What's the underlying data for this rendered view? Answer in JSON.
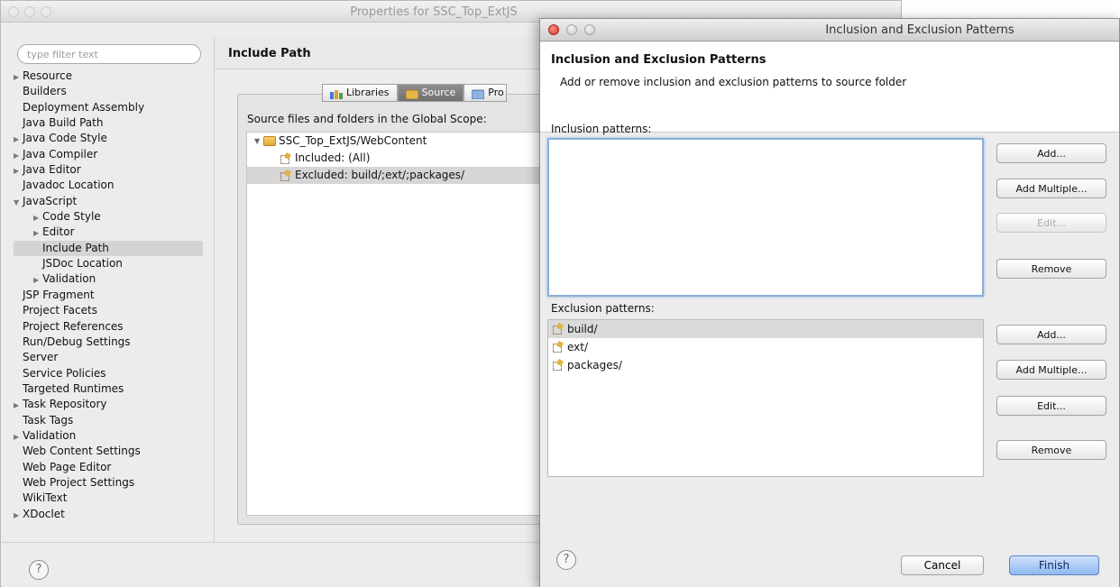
{
  "properties_window": {
    "title": "Properties for SSC_Top_ExtJS",
    "filter": {
      "placeholder": "type filter text",
      "value": ""
    },
    "nav": [
      {
        "label": "Resource",
        "arrow": "▶",
        "level": 0
      },
      {
        "label": "Builders",
        "arrow": "",
        "level": 0
      },
      {
        "label": "Deployment Assembly",
        "arrow": "",
        "level": 0
      },
      {
        "label": "Java Build Path",
        "arrow": "",
        "level": 0
      },
      {
        "label": "Java Code Style",
        "arrow": "▶",
        "level": 0
      },
      {
        "label": "Java Compiler",
        "arrow": "▶",
        "level": 0
      },
      {
        "label": "Java Editor",
        "arrow": "▶",
        "level": 0
      },
      {
        "label": "Javadoc Location",
        "arrow": "",
        "level": 0
      },
      {
        "label": "JavaScript",
        "arrow": "▼",
        "level": 0
      },
      {
        "label": "Code Style",
        "arrow": "▶",
        "level": 1
      },
      {
        "label": "Editor",
        "arrow": "▶",
        "level": 1
      },
      {
        "label": "Include Path",
        "arrow": "",
        "level": 1,
        "selected": true
      },
      {
        "label": "JSDoc Location",
        "arrow": "",
        "level": 1
      },
      {
        "label": "Validation",
        "arrow": "▶",
        "level": 1
      },
      {
        "label": "JSP Fragment",
        "arrow": "",
        "level": 0
      },
      {
        "label": "Project Facets",
        "arrow": "",
        "level": 0
      },
      {
        "label": "Project References",
        "arrow": "",
        "level": 0
      },
      {
        "label": "Run/Debug Settings",
        "arrow": "",
        "level": 0
      },
      {
        "label": "Server",
        "arrow": "",
        "level": 0
      },
      {
        "label": "Service Policies",
        "arrow": "",
        "level": 0
      },
      {
        "label": "Targeted Runtimes",
        "arrow": "",
        "level": 0
      },
      {
        "label": "Task Repository",
        "arrow": "▶",
        "level": 0
      },
      {
        "label": "Task Tags",
        "arrow": "",
        "level": 0
      },
      {
        "label": "Validation",
        "arrow": "▶",
        "level": 0
      },
      {
        "label": "Web Content Settings",
        "arrow": "",
        "level": 0
      },
      {
        "label": "Web Page Editor",
        "arrow": "",
        "level": 0
      },
      {
        "label": "Web Project Settings",
        "arrow": "",
        "level": 0
      },
      {
        "label": "WikiText",
        "arrow": "",
        "level": 0
      },
      {
        "label": "XDoclet",
        "arrow": "▶",
        "level": 0
      }
    ],
    "page_title": "Include Path",
    "tabs": [
      {
        "label": "Libraries",
        "active": false
      },
      {
        "label": "Source",
        "active": true
      },
      {
        "label": "Pro",
        "active": false
      }
    ],
    "scope_label": "Source files and folders in the Global Scope:",
    "source_tree": {
      "root_arrow": "▼",
      "root": "SSC_Top_ExtJS/WebContent",
      "included": "Included: (All)",
      "excluded": "Excluded: build/;ext/;packages/"
    },
    "help_glyph": "?"
  },
  "dialog": {
    "window_title": "Inclusion and Exclusion Patterns",
    "header_title": "Inclusion and Exclusion Patterns",
    "header_description": "Add or remove inclusion and exclusion patterns to source folder",
    "inclusion": {
      "label": "Inclusion patterns:",
      "items": [],
      "buttons": {
        "add": "Add...",
        "add_multiple": "Add Multiple...",
        "edit": "Edit...",
        "remove": "Remove"
      }
    },
    "exclusion": {
      "label": "Exclusion patterns:",
      "items": [
        "build/",
        "ext/",
        "packages/"
      ],
      "buttons": {
        "add": "Add...",
        "add_multiple": "Add Multiple...",
        "edit": "Edit...",
        "remove": "Remove"
      }
    },
    "footer": {
      "help_glyph": "?",
      "cancel": "Cancel",
      "finish": "Finish"
    }
  },
  "colors": {
    "selection_gray": "#d4d4d4",
    "focus_ring": "#8cb0d8",
    "close_red": "#d8382c",
    "finish_blue": "#8fb8ef"
  }
}
